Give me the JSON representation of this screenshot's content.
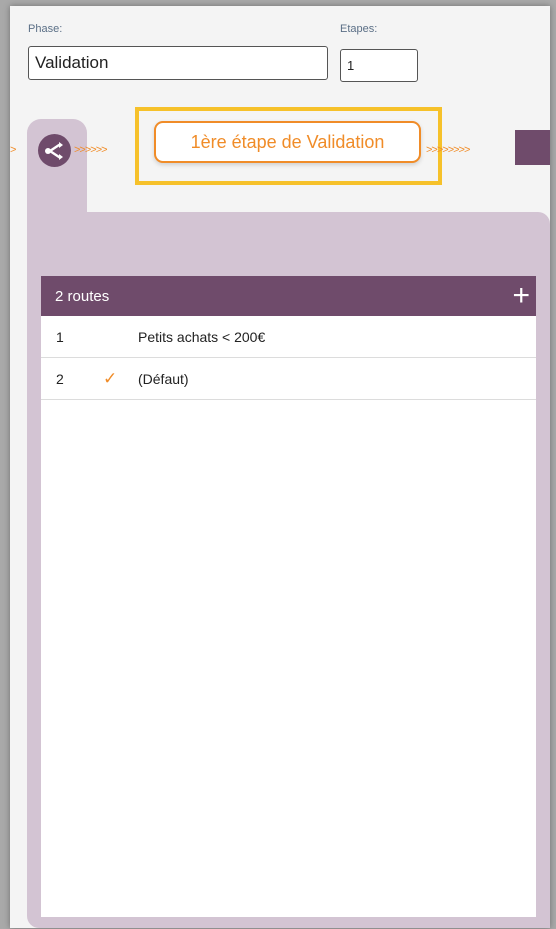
{
  "phase": {
    "label": "Phase:",
    "value": "Validation"
  },
  "etapes": {
    "label": "Etapes:",
    "value": "1"
  },
  "flow": {
    "left_arrows": ">>>>>>",
    "right_arrows": ">>>>>>>>",
    "lead": ">"
  },
  "step": {
    "label": "1ère étape de Validation"
  },
  "routes": {
    "header": "2 routes",
    "add_icon": "plus-icon",
    "rows": [
      {
        "num": "1",
        "checked": false,
        "name": "Petits achats < 200€"
      },
      {
        "num": "2",
        "checked": true,
        "name": "(Défaut)"
      }
    ]
  },
  "colors": {
    "accent": "#f08c28",
    "purple": "#6f4b6b",
    "tab": "#d3c4d3",
    "highlight": "#f6c12a"
  }
}
